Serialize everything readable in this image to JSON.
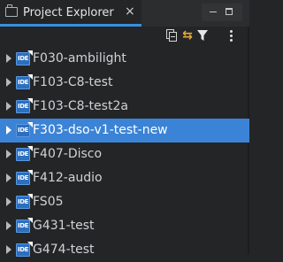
{
  "panel": {
    "title": "Project Explorer",
    "close_symbol": "×",
    "icon": "folder-icon"
  },
  "window_controls": {
    "minimize": "minimize-icon",
    "maximize": "maximize-icon"
  },
  "toolbar": {
    "buttons": [
      "collapse-all-icon",
      "link-with-editor-icon",
      "filter-icon",
      "more-options-icon"
    ]
  },
  "tree": {
    "items": [
      {
        "label": "F030-ambilight",
        "badge": "IDE",
        "selected": false
      },
      {
        "label": "F103-C8-test",
        "badge": "IDE",
        "selected": false
      },
      {
        "label": "F103-C8-test2a",
        "badge": "IDE",
        "selected": false
      },
      {
        "label": "F303-dso-v1-test-new",
        "badge": "IDE",
        "selected": true
      },
      {
        "label": "F407-Disco",
        "badge": "IDE",
        "selected": false
      },
      {
        "label": "F412-audio",
        "badge": "IDE",
        "selected": false
      },
      {
        "label": "FS05",
        "badge": "IDE",
        "selected": false
      },
      {
        "label": "G431-test",
        "badge": "IDE",
        "selected": false
      },
      {
        "label": "G474-test",
        "badge": "IDE",
        "selected": false
      }
    ]
  },
  "colors": {
    "background": "#242526",
    "selection": "#3b83d6",
    "tab_underline": "#3a8fe0",
    "ide_badge": "#2c6fbf"
  }
}
